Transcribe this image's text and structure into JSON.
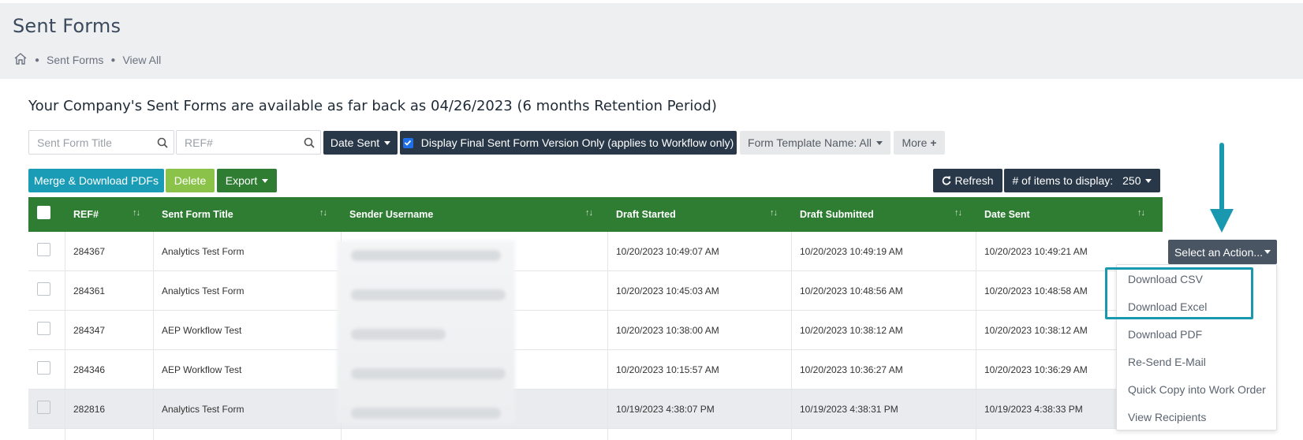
{
  "header": {
    "title": "Sent Forms",
    "breadcrumb": [
      "Sent Forms",
      "View All"
    ]
  },
  "retention_notice": "Your Company's Sent Forms are available as far back as 04/26/2023 (6 months Retention Period)",
  "filters": {
    "title_placeholder": "Sent Form Title",
    "ref_placeholder": "REF#",
    "date_sent": "Date Sent",
    "final_version": "Display Final Sent Form Version Only (applies to Workflow only)",
    "template": "Form Template Name: All",
    "more": "More"
  },
  "toolbar": {
    "merge": "Merge & Download PDFs",
    "delete": "Delete",
    "export": "Export",
    "refresh": "Refresh",
    "items_label": "# of items to display:",
    "items_value": "250"
  },
  "table": {
    "columns": [
      "REF#",
      "Sent Form Title",
      "Sender Username",
      "Draft Started",
      "Draft Submitted",
      "Date Sent"
    ],
    "rows": [
      {
        "ref": "284367",
        "title": "Analytics Test Form",
        "started": "10/20/2023 10:49:07 AM",
        "submitted": "10/20/2023 10:49:19 AM",
        "sent": "10/20/2023 10:49:21 AM"
      },
      {
        "ref": "284361",
        "title": "Analytics Test Form",
        "started": "10/20/2023 10:45:03 AM",
        "submitted": "10/20/2023 10:48:56 AM",
        "sent": "10/20/2023 10:48:58 AM"
      },
      {
        "ref": "284347",
        "title": "AEP Workflow Test",
        "started": "10/20/2023 10:38:00 AM",
        "submitted": "10/20/2023 10:38:12 AM",
        "sent": "10/20/2023 10:38:12 AM"
      },
      {
        "ref": "284346",
        "title": "AEP Workflow Test",
        "started": "10/20/2023 10:15:57 AM",
        "submitted": "10/20/2023 10:36:27 AM",
        "sent": "10/20/2023 10:36:29 AM"
      },
      {
        "ref": "282816",
        "title": "Analytics Test Form",
        "started": "10/19/2023 4:38:07 PM",
        "submitted": "10/19/2023 4:38:31 PM",
        "sent": "10/19/2023 4:38:33 PM"
      }
    ]
  },
  "action": {
    "label": "Select an Action...",
    "menu": [
      "Download CSV",
      "Download Excel",
      "Download PDF",
      "Re-Send E-Mail",
      "Quick Copy into Work Order",
      "View Recipients"
    ]
  },
  "colors": {
    "table_header": "#2e7d32",
    "accent_teal": "#1a98b0",
    "dark_button": "#283849"
  }
}
